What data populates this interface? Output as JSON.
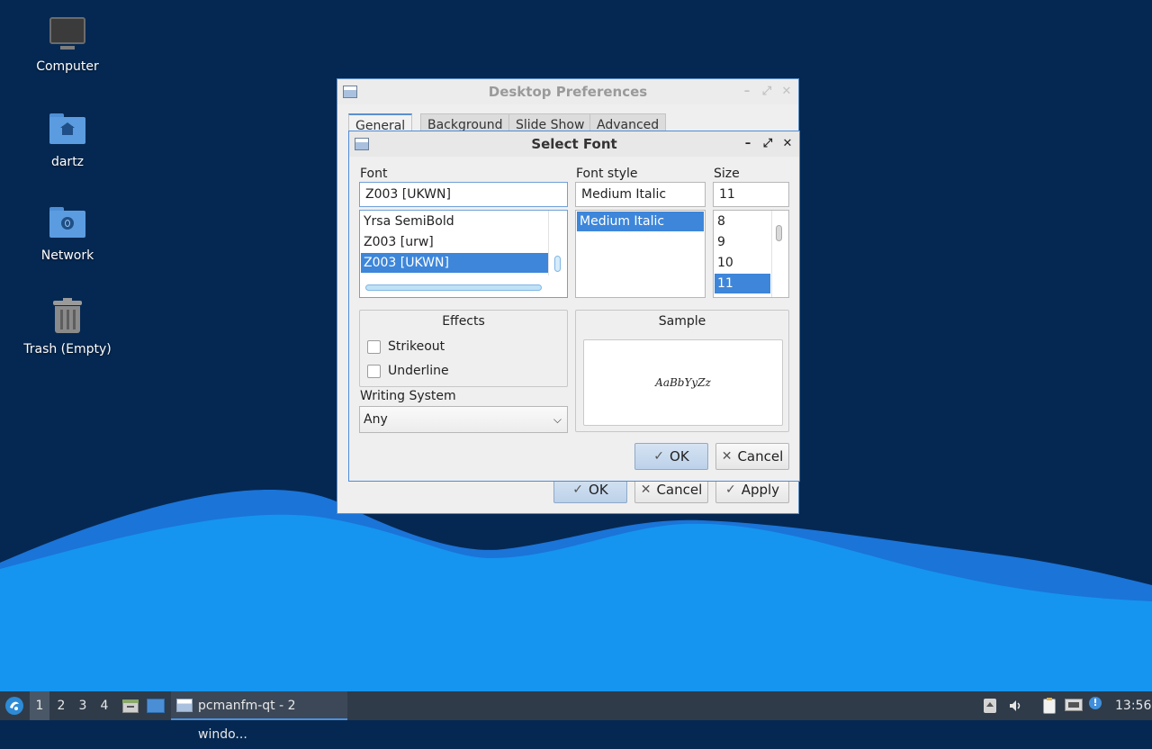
{
  "colors": {
    "desktop_bg": "#052852",
    "wave_back": "#1b74d8",
    "wave_front": "#1595f0",
    "selection": "#3d86da",
    "taskbar_bg": "#2f3b49"
  },
  "desktop": {
    "icons": [
      {
        "label": "Computer",
        "icon": "monitor-icon"
      },
      {
        "label": "dartz",
        "icon": "home-folder-icon"
      },
      {
        "label": "Network",
        "icon": "network-folder-icon"
      },
      {
        "label": "Trash (Empty)",
        "icon": "trash-icon"
      }
    ]
  },
  "prefs_window": {
    "title": "Desktop Preferences",
    "tabs": [
      "General",
      "Background",
      "Slide Show",
      "Advanced"
    ],
    "buttons": {
      "ok": "OK",
      "cancel": "Cancel",
      "apply": "Apply"
    }
  },
  "font_dialog": {
    "title": "Select Font",
    "font_label": "Font",
    "font_value": "Z003 [UKWN]",
    "font_list": [
      "Yrsa SemiBold",
      "Z003 [urw]",
      "Z003 [UKWN]"
    ],
    "font_selected_index": 2,
    "style_label": "Font style",
    "style_value": "Medium Italic",
    "style_list": [
      "Medium Italic"
    ],
    "size_label": "Size",
    "size_value": "11",
    "size_list": [
      "8",
      "9",
      "10",
      "11"
    ],
    "size_selected_index": 3,
    "effects": {
      "title": "Effects",
      "strikeout": "Strikeout",
      "underline": "Underline",
      "strikeout_checked": false,
      "underline_checked": false
    },
    "writing_system_label": "Writing System",
    "writing_system_value": "Any",
    "sample": {
      "title": "Sample",
      "text": "AaBbYyZz"
    },
    "buttons": {
      "ok": "OK",
      "cancel": "Cancel"
    }
  },
  "taskbar": {
    "workspaces": [
      "1",
      "2",
      "3",
      "4"
    ],
    "active_workspace": "1",
    "task_label": "pcmanfm-qt - 2 windo...",
    "clock": "13:56"
  }
}
